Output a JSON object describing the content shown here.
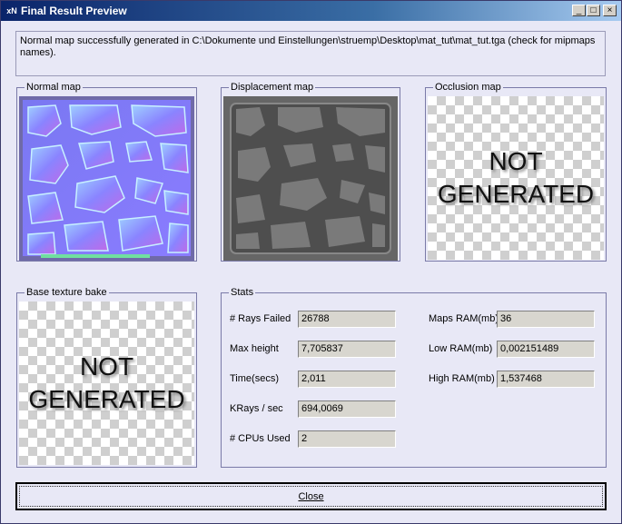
{
  "window": {
    "title": "Final Result Preview",
    "app_icon": "xN",
    "controls": {
      "minimize": "_",
      "maximize": "□",
      "close": "×"
    }
  },
  "message": "Normal map successfully generated in C:\\Dokumente und Einstellungen\\struemp\\Desktop\\mat_tut\\mat_tut.tga (check for mipmaps names).",
  "groups": {
    "normal_map": "Normal map",
    "displacement_map": "Displacement map",
    "occlusion_map": "Occlusion map",
    "base_texture": "Base texture bake",
    "stats": "Stats"
  },
  "not_generated": {
    "line1": "NOT",
    "line2": "GENERATED"
  },
  "stats": {
    "rays_failed": {
      "label": "# Rays Failed",
      "value": "26788"
    },
    "max_height": {
      "label": "Max height",
      "value": "7,705837"
    },
    "time": {
      "label": "Time(secs)",
      "value": "2,011"
    },
    "krays": {
      "label": "KRays / sec",
      "value": "694,0069"
    },
    "cpus": {
      "label": "# CPUs Used",
      "value": "2"
    },
    "maps_ram": {
      "label": "Maps RAM(mb)",
      "value": "36"
    },
    "low_ram": {
      "label": "Low RAM(mb)",
      "value": "0,002151489"
    },
    "high_ram": {
      "label": "High RAM(mb)",
      "value": "1,537468"
    }
  },
  "close_button": "Close",
  "colors": {
    "normal_map_base": "#8a80ff",
    "displacement_base": "#5c5c5c",
    "titlebar": "#0a246a"
  }
}
